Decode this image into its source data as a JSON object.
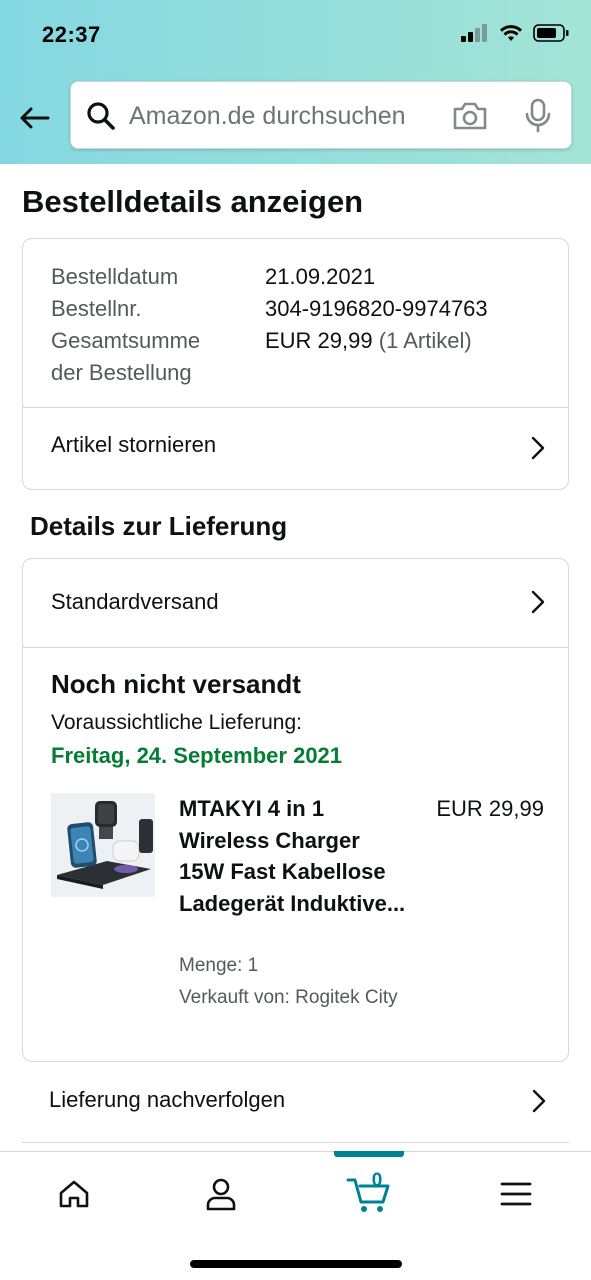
{
  "status_bar": {
    "time": "22:37"
  },
  "search": {
    "placeholder": "Amazon.de durchsuchen"
  },
  "page": {
    "title": "Bestelldetails anzeigen"
  },
  "order_summary": {
    "rows": [
      {
        "label": "Bestelldatum",
        "value": "21.09.2021"
      },
      {
        "label": "Bestellnr.",
        "value": "304-9196820-9974763"
      }
    ],
    "total_label_line1": "Gesamtsumme",
    "total_label_line2": "der Bestellung",
    "total_value": "EUR 29,99",
    "total_count": "(1 Artikel)",
    "cancel_label": "Artikel stornieren"
  },
  "delivery": {
    "section_title": "Details zur Lieferung",
    "shipping_method": "Standardversand",
    "status": "Noch nicht versandt",
    "eta_label": "Voraussichtliche Lieferung:",
    "eta_date": "Freitag, 24. September 2021",
    "product": {
      "title": "MTAKYI 4 in 1 Wireless Charger 15W Fast Kabellose Ladegerät Induktive...",
      "price": "EUR 29,99",
      "quantity": "Menge: 1",
      "seller": "Verkauft von: Rogitek City"
    },
    "track_label": "Lieferung nachverfolgen"
  },
  "bottom_nav": {
    "cart_count": "0"
  },
  "colors": {
    "accent": "#008296",
    "delivery_green": "#067d34",
    "text": "#0f1111",
    "muted": "#565959",
    "border": "#d5d9d9"
  },
  "icons": [
    "back-arrow-icon",
    "search-icon",
    "camera-icon",
    "mic-icon",
    "chevron-right-icon",
    "home-icon",
    "account-icon",
    "cart-icon",
    "menu-icon"
  ]
}
